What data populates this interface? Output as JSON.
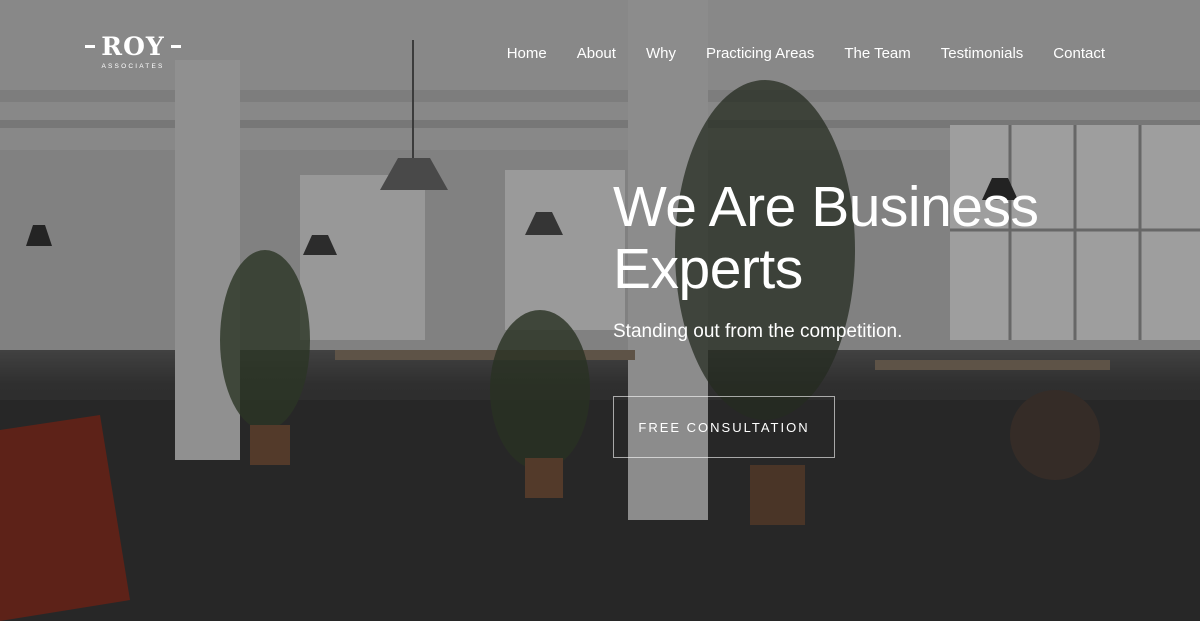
{
  "brand": {
    "name": "ROY",
    "tagline": "ASSOCIATES"
  },
  "nav": {
    "items": [
      {
        "label": "Home"
      },
      {
        "label": "About"
      },
      {
        "label": "Why"
      },
      {
        "label": "Practicing Areas"
      },
      {
        "label": "The Team"
      },
      {
        "label": "Testimonials"
      },
      {
        "label": "Contact"
      }
    ]
  },
  "hero": {
    "title": "We Are Business Experts",
    "subtitle": "Standing out from the competition.",
    "cta_label": "FREE CONSULTATION",
    "background": "open-plan-office-photo"
  },
  "colors": {
    "text": "#ffffff",
    "overlay": "#141414"
  }
}
